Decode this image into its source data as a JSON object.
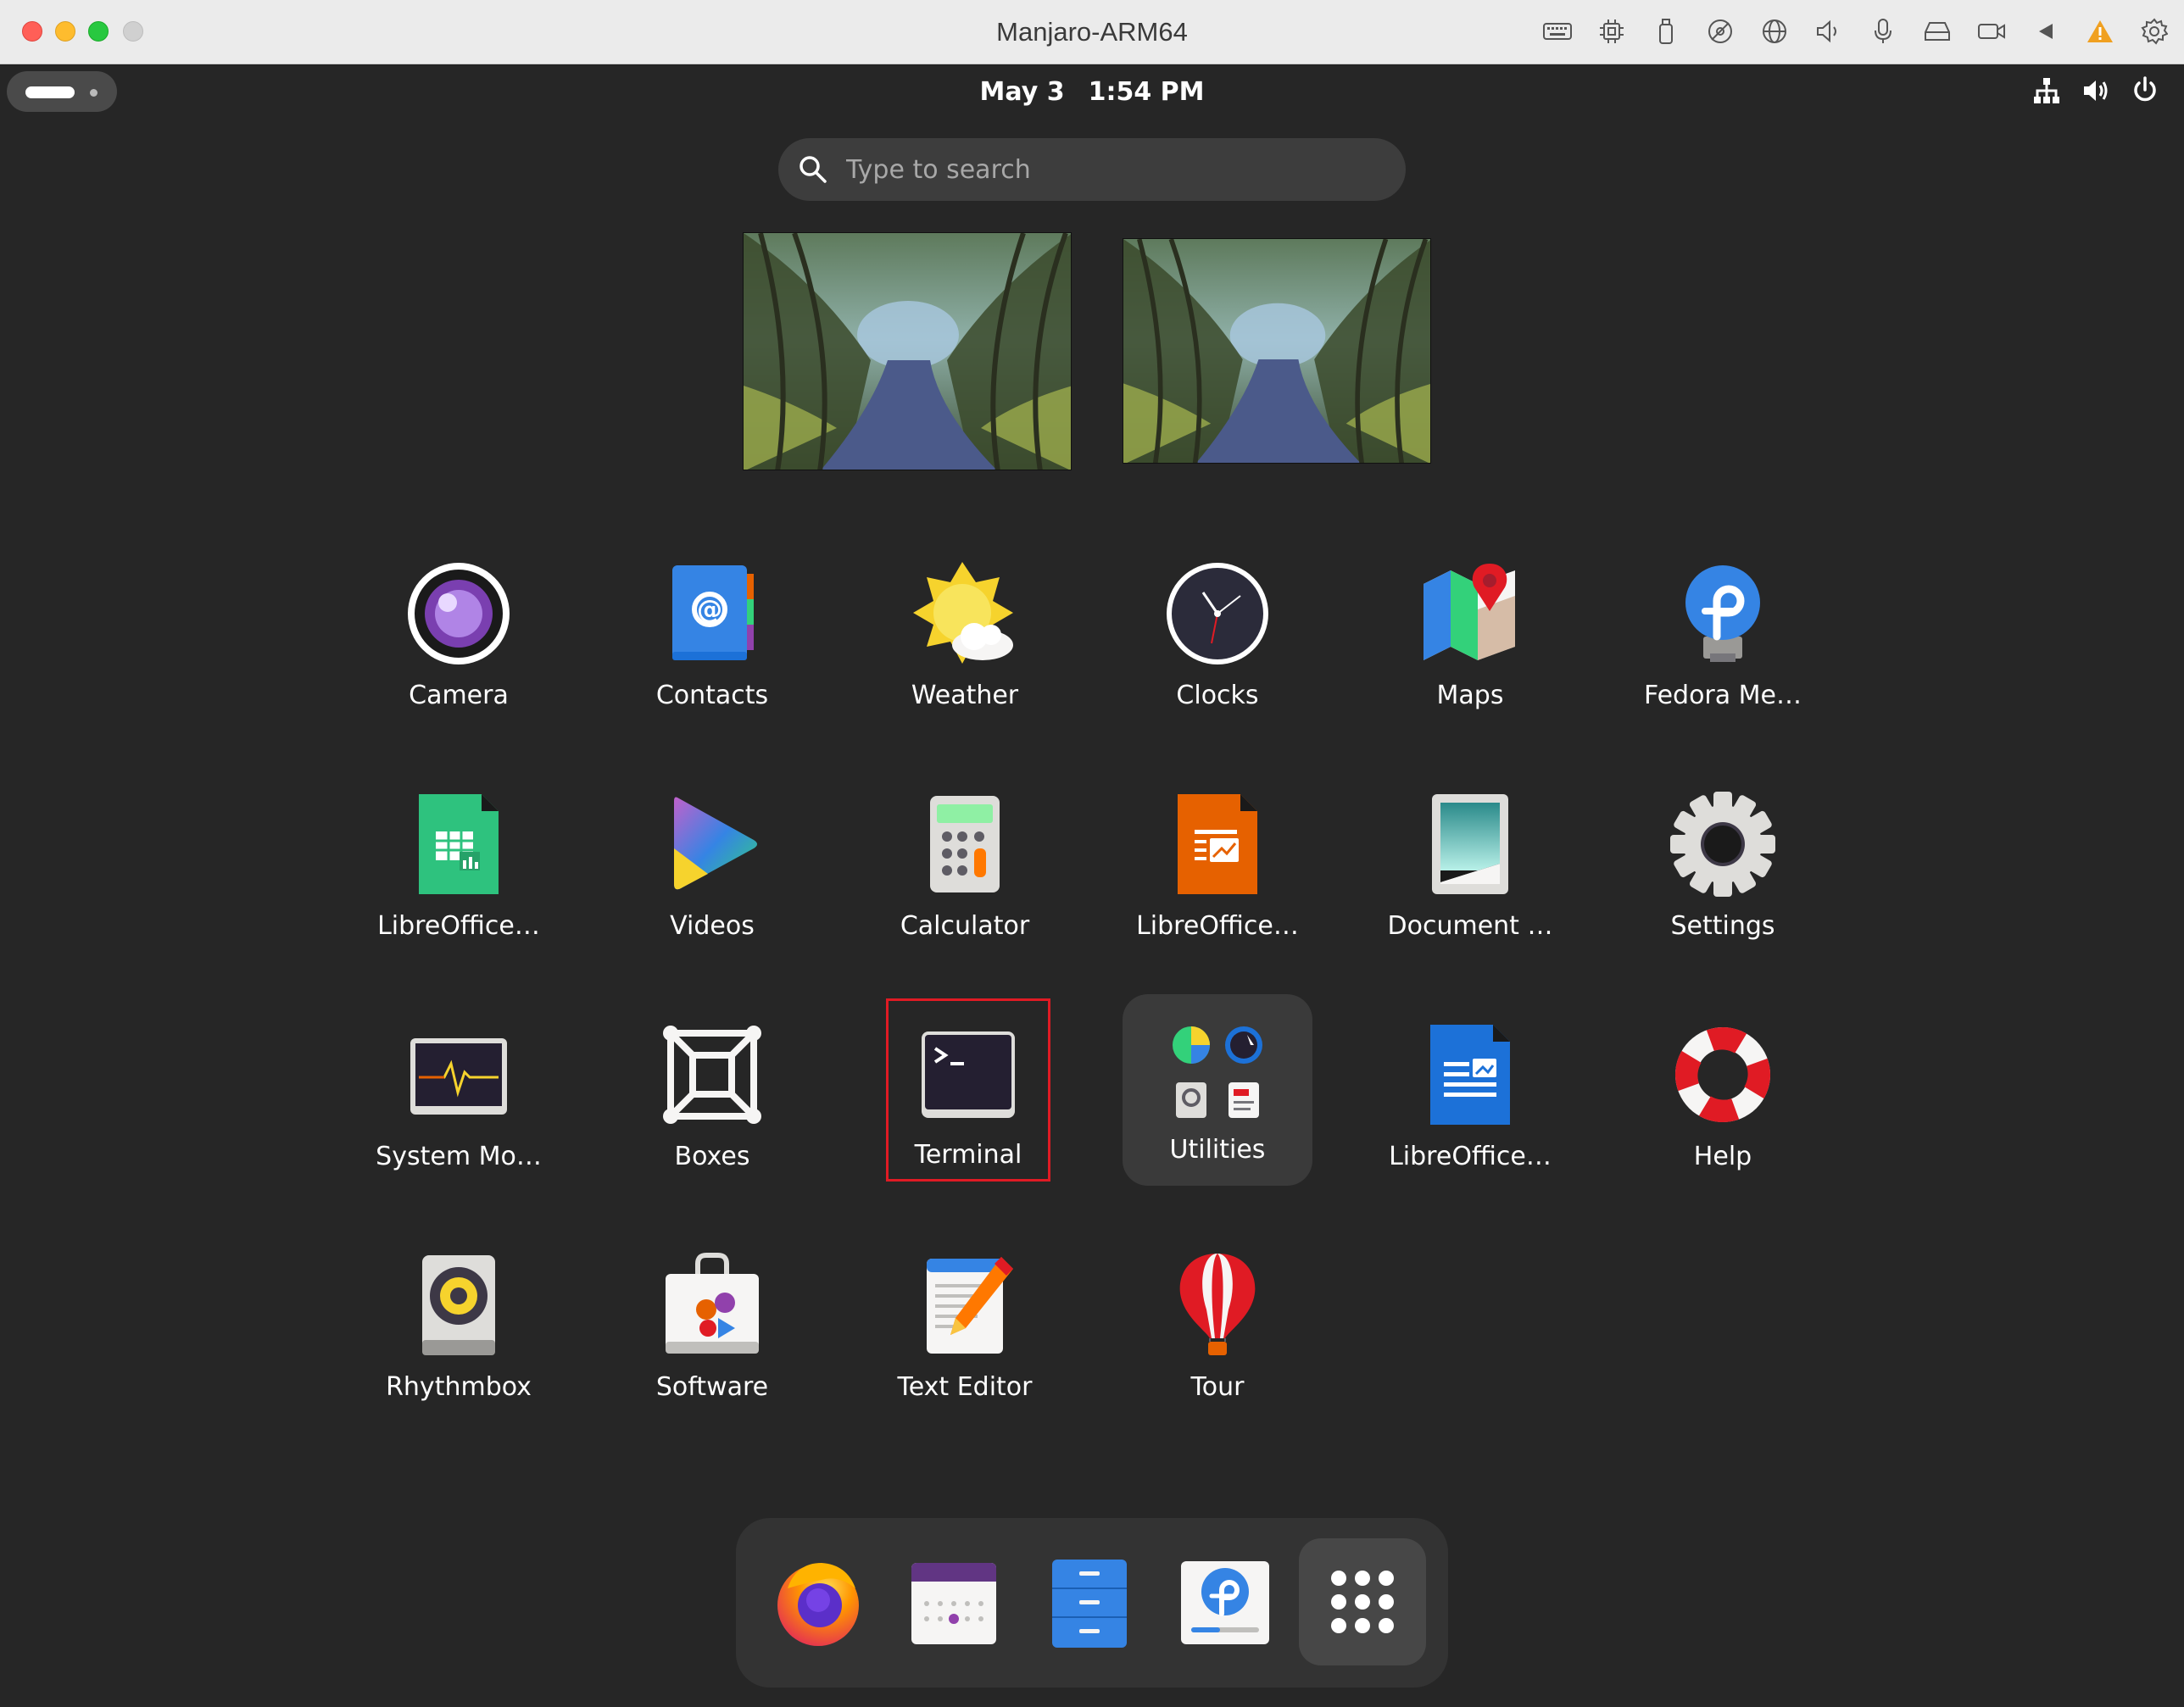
{
  "window": {
    "title": "Manjaro-ARM64"
  },
  "topbar": {
    "date": "May 3",
    "time": "1:54 PM"
  },
  "search": {
    "placeholder": "Type to search"
  },
  "apps": [
    {
      "label": "Camera",
      "icon": "camera-icon"
    },
    {
      "label": "Contacts",
      "icon": "contacts-icon"
    },
    {
      "label": "Weather",
      "icon": "weather-icon"
    },
    {
      "label": "Clocks",
      "icon": "clock-icon"
    },
    {
      "label": "Maps",
      "icon": "maps-icon"
    },
    {
      "label": "Fedora Me…",
      "icon": "fedora-media-writer-icon"
    },
    {
      "label": "LibreOffice…",
      "icon": "libreoffice-calc-icon"
    },
    {
      "label": "Videos",
      "icon": "videos-icon"
    },
    {
      "label": "Calculator",
      "icon": "calculator-icon"
    },
    {
      "label": "LibreOffice…",
      "icon": "libreoffice-impress-icon"
    },
    {
      "label": "Document …",
      "icon": "document-viewer-icon"
    },
    {
      "label": "Settings",
      "icon": "settings-gear-icon"
    },
    {
      "label": "System Mo…",
      "icon": "system-monitor-icon"
    },
    {
      "label": "Boxes",
      "icon": "boxes-icon"
    },
    {
      "label": "Terminal",
      "icon": "terminal-icon"
    },
    {
      "label": "Utilities",
      "icon": "utilities-folder-icon"
    },
    {
      "label": "LibreOffice…",
      "icon": "libreoffice-writer-icon"
    },
    {
      "label": "Help",
      "icon": "help-lifebuoy-icon"
    },
    {
      "label": "Rhythmbox",
      "icon": "rhythmbox-icon"
    },
    {
      "label": "Software",
      "icon": "software-icon"
    },
    {
      "label": "Text Editor",
      "icon": "text-editor-icon"
    },
    {
      "label": "Tour",
      "icon": "tour-balloon-icon"
    }
  ],
  "dock": [
    {
      "name": "firefox",
      "icon": "firefox-icon"
    },
    {
      "name": "calendar",
      "icon": "calendar-icon"
    },
    {
      "name": "files",
      "icon": "files-icon"
    },
    {
      "name": "fedora-media-writer",
      "icon": "fedora-installer-icon"
    },
    {
      "name": "show-apps",
      "icon": "app-grid-icon"
    }
  ],
  "colors": {
    "selection": "#e01b24",
    "desktop": "#262626",
    "accent": "#3584e4"
  }
}
